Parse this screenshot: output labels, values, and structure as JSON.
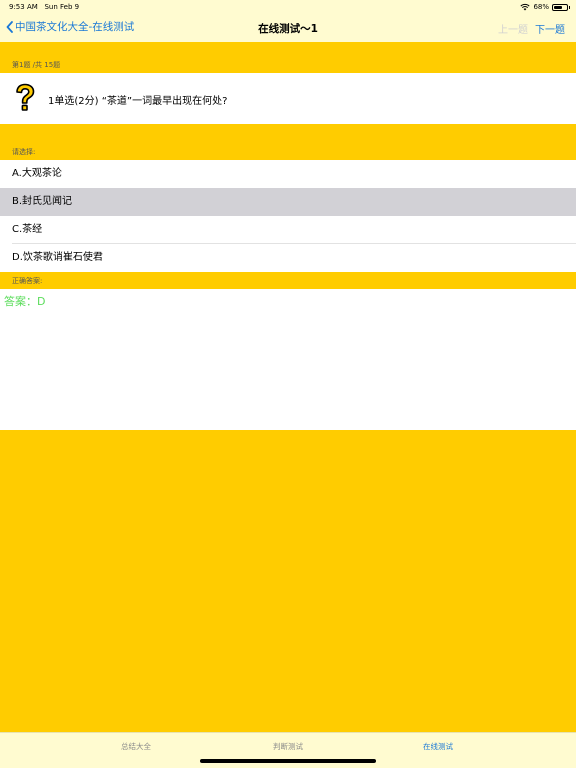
{
  "status": {
    "time": "9:53 AM",
    "date": "Sun Feb 9",
    "battery": "68%",
    "battery_level": 0.68
  },
  "nav": {
    "back_label": "中国茶文化大全-在线测试",
    "title": "在线测试～1",
    "prev_label": "上一题",
    "next_label": "下一题"
  },
  "question": {
    "progress": "第1题 /共 15题",
    "text": "1单选(2分) “茶道”一词最早出现在何处?"
  },
  "choices": {
    "label": "请选择:",
    "options": [
      {
        "label": "A.大观茶论"
      },
      {
        "label": "B.封氏见闻记",
        "selected": true
      },
      {
        "label": "C.茶经"
      },
      {
        "label": "D.饮茶歌诮崔石使君"
      }
    ]
  },
  "answer": {
    "label": "正确答案:",
    "text": "答案：D"
  },
  "tabs": [
    {
      "label": "总结大全"
    },
    {
      "label": "判断测试"
    },
    {
      "label": "在线测试",
      "active": true
    }
  ],
  "colors": {
    "accent": "#1a78d6",
    "background": "#ffcc00",
    "bar": "#fffbd0",
    "selected": "#d2d1d6",
    "answer": "#5bdc5b"
  }
}
